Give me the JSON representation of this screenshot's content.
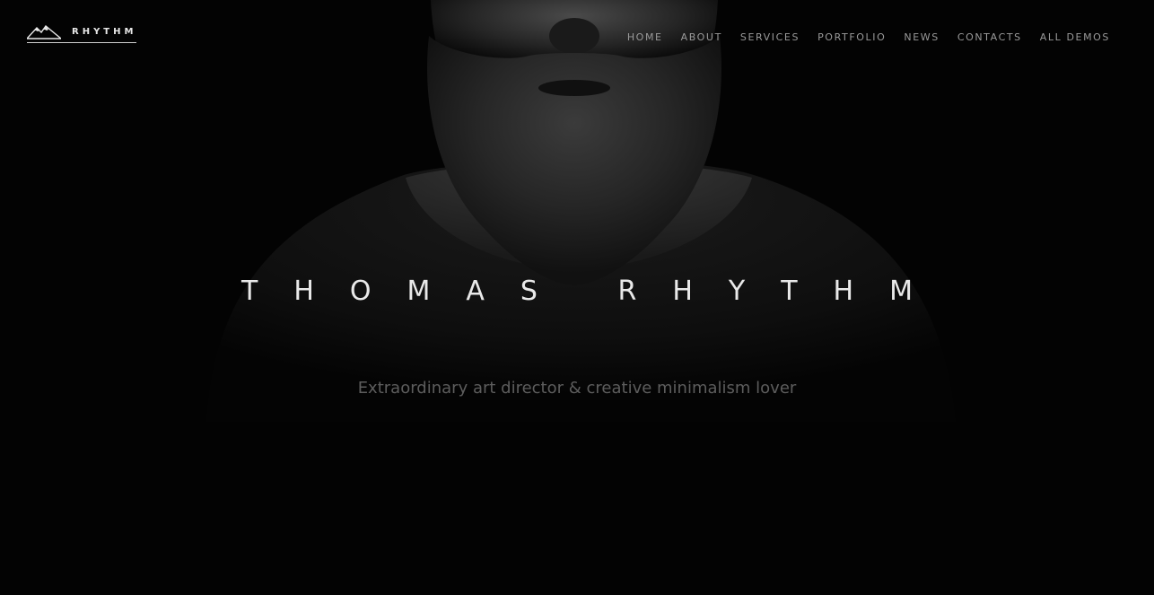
{
  "header": {
    "logo_text": "RHYTHM",
    "logo_icon": "mountain-icon"
  },
  "nav": {
    "items": [
      {
        "label": "HOME"
      },
      {
        "label": "ABOUT"
      },
      {
        "label": "SERVICES"
      },
      {
        "label": "PORTFOLIO"
      },
      {
        "label": "NEWS"
      },
      {
        "label": "CONTACTS"
      },
      {
        "label": "ALL DEMOS"
      }
    ]
  },
  "hero": {
    "title": "THOMAS RHYTHM",
    "subtitle": "Extraordinary art director & creative minimalism lover"
  },
  "colors": {
    "background": "#030303",
    "title": "#e9e9e9",
    "subtitle": "#5d5d5d",
    "nav": "#9a9a9a"
  }
}
